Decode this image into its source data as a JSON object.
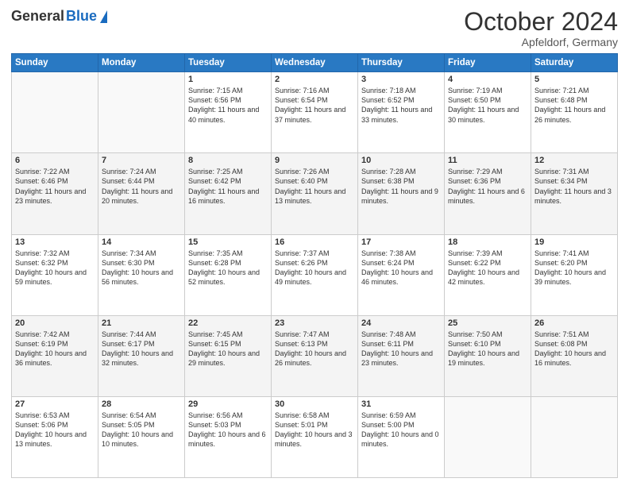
{
  "header": {
    "logo_general": "General",
    "logo_blue": "Blue",
    "month": "October 2024",
    "location": "Apfeldorf, Germany"
  },
  "days_of_week": [
    "Sunday",
    "Monday",
    "Tuesday",
    "Wednesday",
    "Thursday",
    "Friday",
    "Saturday"
  ],
  "weeks": [
    [
      {
        "day": "",
        "info": ""
      },
      {
        "day": "",
        "info": ""
      },
      {
        "day": "1",
        "info": "Sunrise: 7:15 AM\nSunset: 6:56 PM\nDaylight: 11 hours and 40 minutes."
      },
      {
        "day": "2",
        "info": "Sunrise: 7:16 AM\nSunset: 6:54 PM\nDaylight: 11 hours and 37 minutes."
      },
      {
        "day": "3",
        "info": "Sunrise: 7:18 AM\nSunset: 6:52 PM\nDaylight: 11 hours and 33 minutes."
      },
      {
        "day": "4",
        "info": "Sunrise: 7:19 AM\nSunset: 6:50 PM\nDaylight: 11 hours and 30 minutes."
      },
      {
        "day": "5",
        "info": "Sunrise: 7:21 AM\nSunset: 6:48 PM\nDaylight: 11 hours and 26 minutes."
      }
    ],
    [
      {
        "day": "6",
        "info": "Sunrise: 7:22 AM\nSunset: 6:46 PM\nDaylight: 11 hours and 23 minutes."
      },
      {
        "day": "7",
        "info": "Sunrise: 7:24 AM\nSunset: 6:44 PM\nDaylight: 11 hours and 20 minutes."
      },
      {
        "day": "8",
        "info": "Sunrise: 7:25 AM\nSunset: 6:42 PM\nDaylight: 11 hours and 16 minutes."
      },
      {
        "day": "9",
        "info": "Sunrise: 7:26 AM\nSunset: 6:40 PM\nDaylight: 11 hours and 13 minutes."
      },
      {
        "day": "10",
        "info": "Sunrise: 7:28 AM\nSunset: 6:38 PM\nDaylight: 11 hours and 9 minutes."
      },
      {
        "day": "11",
        "info": "Sunrise: 7:29 AM\nSunset: 6:36 PM\nDaylight: 11 hours and 6 minutes."
      },
      {
        "day": "12",
        "info": "Sunrise: 7:31 AM\nSunset: 6:34 PM\nDaylight: 11 hours and 3 minutes."
      }
    ],
    [
      {
        "day": "13",
        "info": "Sunrise: 7:32 AM\nSunset: 6:32 PM\nDaylight: 10 hours and 59 minutes."
      },
      {
        "day": "14",
        "info": "Sunrise: 7:34 AM\nSunset: 6:30 PM\nDaylight: 10 hours and 56 minutes."
      },
      {
        "day": "15",
        "info": "Sunrise: 7:35 AM\nSunset: 6:28 PM\nDaylight: 10 hours and 52 minutes."
      },
      {
        "day": "16",
        "info": "Sunrise: 7:37 AM\nSunset: 6:26 PM\nDaylight: 10 hours and 49 minutes."
      },
      {
        "day": "17",
        "info": "Sunrise: 7:38 AM\nSunset: 6:24 PM\nDaylight: 10 hours and 46 minutes."
      },
      {
        "day": "18",
        "info": "Sunrise: 7:39 AM\nSunset: 6:22 PM\nDaylight: 10 hours and 42 minutes."
      },
      {
        "day": "19",
        "info": "Sunrise: 7:41 AM\nSunset: 6:20 PM\nDaylight: 10 hours and 39 minutes."
      }
    ],
    [
      {
        "day": "20",
        "info": "Sunrise: 7:42 AM\nSunset: 6:19 PM\nDaylight: 10 hours and 36 minutes."
      },
      {
        "day": "21",
        "info": "Sunrise: 7:44 AM\nSunset: 6:17 PM\nDaylight: 10 hours and 32 minutes."
      },
      {
        "day": "22",
        "info": "Sunrise: 7:45 AM\nSunset: 6:15 PM\nDaylight: 10 hours and 29 minutes."
      },
      {
        "day": "23",
        "info": "Sunrise: 7:47 AM\nSunset: 6:13 PM\nDaylight: 10 hours and 26 minutes."
      },
      {
        "day": "24",
        "info": "Sunrise: 7:48 AM\nSunset: 6:11 PM\nDaylight: 10 hours and 23 minutes."
      },
      {
        "day": "25",
        "info": "Sunrise: 7:50 AM\nSunset: 6:10 PM\nDaylight: 10 hours and 19 minutes."
      },
      {
        "day": "26",
        "info": "Sunrise: 7:51 AM\nSunset: 6:08 PM\nDaylight: 10 hours and 16 minutes."
      }
    ],
    [
      {
        "day": "27",
        "info": "Sunrise: 6:53 AM\nSunset: 5:06 PM\nDaylight: 10 hours and 13 minutes."
      },
      {
        "day": "28",
        "info": "Sunrise: 6:54 AM\nSunset: 5:05 PM\nDaylight: 10 hours and 10 minutes."
      },
      {
        "day": "29",
        "info": "Sunrise: 6:56 AM\nSunset: 5:03 PM\nDaylight: 10 hours and 6 minutes."
      },
      {
        "day": "30",
        "info": "Sunrise: 6:58 AM\nSunset: 5:01 PM\nDaylight: 10 hours and 3 minutes."
      },
      {
        "day": "31",
        "info": "Sunrise: 6:59 AM\nSunset: 5:00 PM\nDaylight: 10 hours and 0 minutes."
      },
      {
        "day": "",
        "info": ""
      },
      {
        "day": "",
        "info": ""
      }
    ]
  ]
}
